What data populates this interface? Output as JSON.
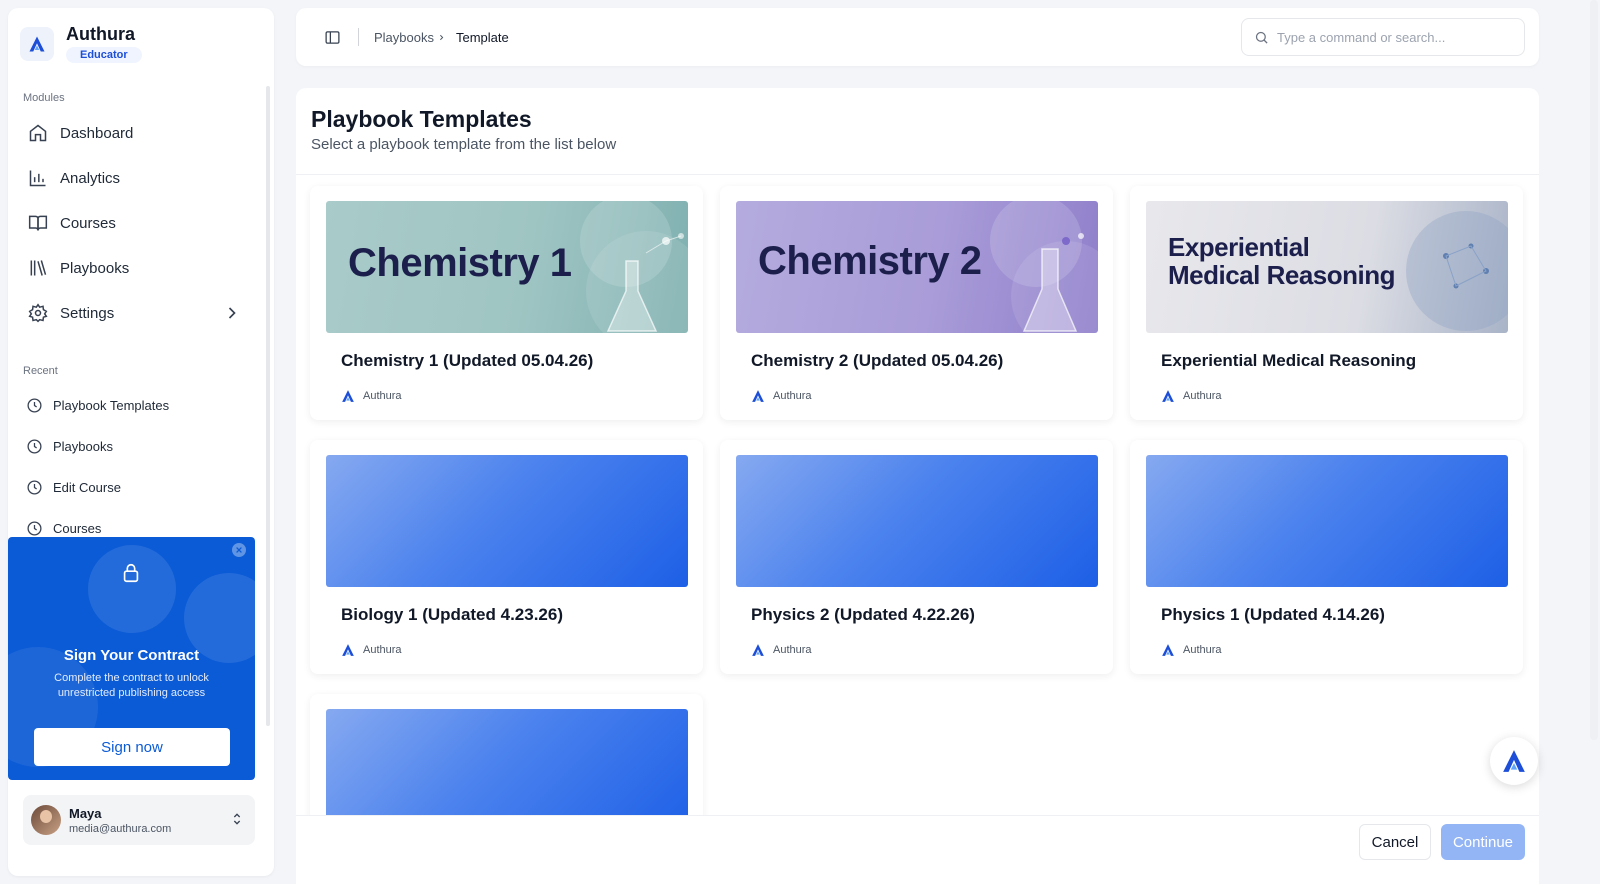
{
  "brand": {
    "name": "Authura",
    "role": "Educator"
  },
  "sidebar": {
    "modules_label": "Modules",
    "items": [
      {
        "label": "Dashboard",
        "icon": "home-icon"
      },
      {
        "label": "Analytics",
        "icon": "bar-chart-icon"
      },
      {
        "label": "Courses",
        "icon": "book-icon"
      },
      {
        "label": "Playbooks",
        "icon": "library-icon"
      },
      {
        "label": "Settings",
        "icon": "gear-icon"
      }
    ],
    "recent_label": "Recent",
    "recent": [
      {
        "label": "Playbook Templates"
      },
      {
        "label": "Playbooks"
      },
      {
        "label": "Edit Course"
      },
      {
        "label": "Courses"
      }
    ]
  },
  "promo": {
    "title": "Sign Your Contract",
    "text": "Complete the contract to unlock unrestricted publishing access",
    "button": "Sign now"
  },
  "user": {
    "name": "Maya",
    "email": "media@authura.com"
  },
  "topbar": {
    "breadcrumb": [
      "Playbooks",
      "Template"
    ],
    "search_placeholder": "Type a command or search..."
  },
  "page": {
    "title": "Playbook Templates",
    "subtitle": "Select a playbook template from the list below"
  },
  "templates": [
    {
      "title": "Chemistry 1 (Updated 05.04.26)",
      "author": "Authura",
      "image_text": "Chemistry 1"
    },
    {
      "title": "Chemistry 2 (Updated 05.04.26)",
      "author": "Authura",
      "image_text": "Chemistry 2"
    },
    {
      "title": "Experiential Medical Reasoning",
      "author": "Authura",
      "image_text_1": "Experiential",
      "image_text_2": "Medical Reasoning"
    },
    {
      "title": "Biology 1 (Updated 4.23.26)",
      "author": "Authura"
    },
    {
      "title": "Physics 2 (Updated 4.22.26)",
      "author": "Authura"
    },
    {
      "title": "Physics 1 (Updated 4.14.26)",
      "author": "Authura"
    },
    {
      "title": "",
      "author": ""
    }
  ],
  "footer": {
    "cancel": "Cancel",
    "continue": "Continue"
  },
  "colors": {
    "accent": "#0b5bd6",
    "continue_disabled": "#93b5f6"
  }
}
